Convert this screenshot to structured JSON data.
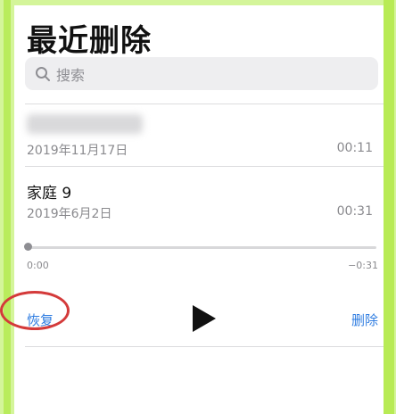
{
  "page": {
    "title": "最近删除",
    "search": {
      "placeholder": "搜索",
      "icon": "search-icon"
    },
    "recordings": [
      {
        "title_blurred": true,
        "date": "2019年11月17日",
        "duration": "00:11"
      },
      {
        "title": "家庭 9",
        "date": "2019年6月2日",
        "duration": "00:31"
      }
    ],
    "player": {
      "elapsed": "0:00",
      "remaining": "−0:31",
      "progress": 0
    },
    "actions": {
      "restore": "恢复",
      "play_icon": "play-icon",
      "delete": "删除"
    }
  },
  "colors": {
    "accent": "#2f7de1",
    "annotation": "#d43a3a",
    "border": "#c8f07a"
  }
}
